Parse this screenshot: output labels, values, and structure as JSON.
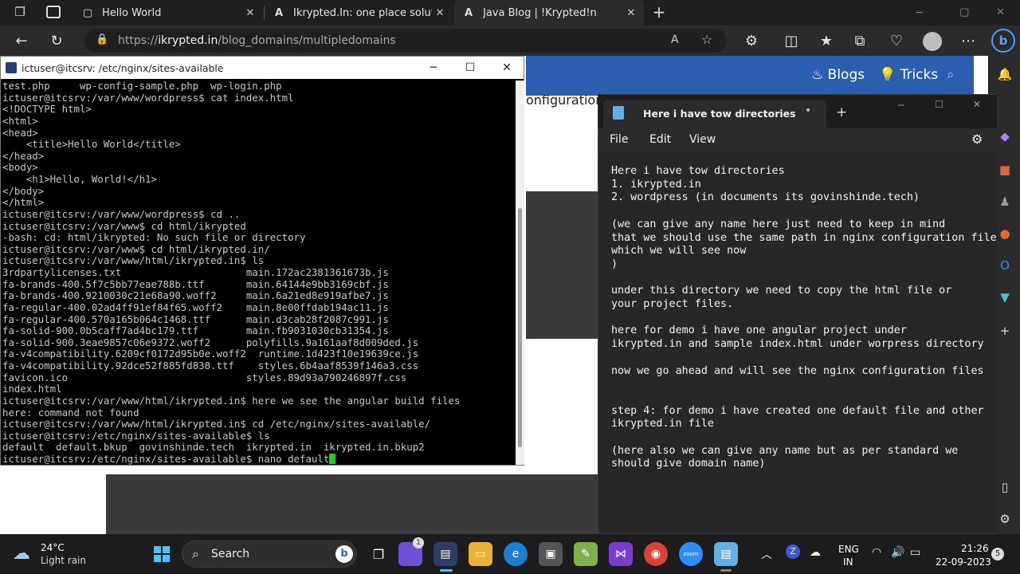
{
  "browser": {
    "tabs": [
      {
        "label": "Hello World"
      },
      {
        "label": "Ikrypted.In: one place solution fo"
      },
      {
        "label": "Java Blog | !Krypted!n"
      }
    ],
    "url_prefix": "https://",
    "url_host": "ikrypted.in",
    "url_path": "/blog_domains/multipledomains"
  },
  "website": {
    "nav": {
      "blogs": "Blogs",
      "tricks": "Tricks"
    },
    "partial_text": "onfiguration"
  },
  "terminal": {
    "title": "ictuser@itcsrv: /etc/nginx/sites-available",
    "lines": [
      "test.php     wp-config-sample.php  wp-login.php",
      "ictuser@itcsrv:/var/www/wordpress$ cat index.html",
      "<!DOCTYPE html>",
      "<html>",
      "<head>",
      "    <title>Hello World</title>",
      "</head>",
      "<body>",
      "    <h1>Hello, World!</h1>",
      "</body>",
      "</html>",
      "ictuser@itcsrv:/var/www/wordpress$ cd ..",
      "ictuser@itcsrv:/var/www$ cd html/ikrypted",
      "-bash: cd: html/ikrypted: No such file or directory",
      "ictuser@itcsrv:/var/www$ cd html/ikrypted.in/",
      "ictuser@itcsrv:/var/www/html/ikrypted.in$ ls",
      "3rdpartylicenses.txt                     main.172ac2381361673b.js",
      "fa-brands-400.5f7c5bb77eae788b.ttf       main.64144e9bb3169cbf.js",
      "fa-brands-400.9210030c21e68a90.woff2     main.6a21ed8e919afbe7.js",
      "fa-regular-400.02ad4ff91ef84f65.woff2    main.8e00ffdab194ac11.js",
      "fa-regular-400.570a165b064c1468.ttf      main.d3cab28f2087c991.js",
      "fa-solid-900.0b5caff7ad4bc179.ttf        main.fb9031030cb31354.js",
      "fa-solid-900.3eae9857c06e9372.woff2      polyfills.9a161aaf8d009ded.js",
      "fa-v4compatibility.6209cf0172d95b0e.woff2  runtime.1d423f10e19639ce.js",
      "fa-v4compatibility.92dce52f885fd838.ttf    styles.6b4aaf8539f146a3.css",
      "favicon.ico                              styles.89d93a790246897f.css",
      "index.html",
      "ictuser@itcsrv:/var/www/html/ikrypted.in$ here we see the angular build files",
      "here: command not found",
      "ictuser@itcsrv:/var/www/html/ikrypted.in$ cd /etc/nginx/sites-available/",
      "ictuser@itcsrv:/etc/nginx/sites-available$ ls",
      "default  default.bkup  govinshinde.tech  ikrypted.in  ikrypted.in.bkup2"
    ],
    "last_line": "ictuser@itcsrv:/etc/nginx/sites-available$ nano default"
  },
  "notepad": {
    "tab_title": "Here i have tow directories",
    "menu": {
      "file": "File",
      "edit": "Edit",
      "view": "View"
    },
    "content": "Here i have tow directories\n1. ikrypted.in\n2. wordpress (in documents its govinshinde.tech)\n\n(we can give any name here just need to keep in mind\nthat we should use the same path in nginx configuration file\nwhich we will see now\n)\n\nunder this directory we need to copy the html file or\nyour project files.\n\nhere for demo i have one angular project under\nikrypted.in and sample index.html under worpress directory\n\nnow we go ahead and will see the nginx configuration files\n\n\nstep 4: for demo i have created one default file and other\nikrypted.in file\n\n(here also we can give any name but as per standard we\nshould give domain name)"
  },
  "taskbar": {
    "weather_temp": "24°C",
    "weather_desc": "Light rain",
    "search_label": "Search",
    "lang_top": "ENG",
    "lang_bottom": "IN",
    "time": "21:26",
    "date": "22-09-2023",
    "notif_count": "5",
    "chat_badge": "1"
  }
}
